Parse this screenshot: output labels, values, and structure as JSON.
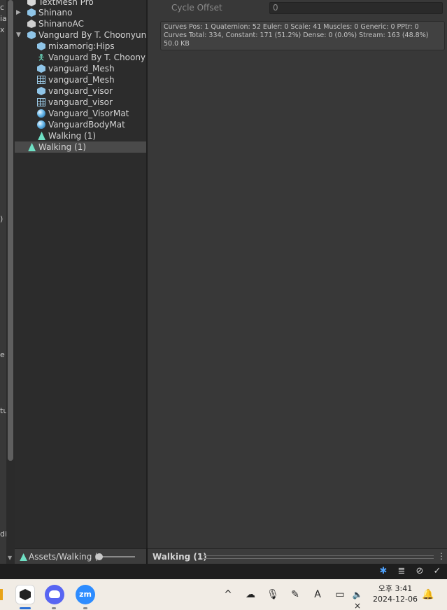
{
  "left_strip_fragments": [
    "c",
    "ia",
    "x",
    ")",
    "e",
    "tu",
    "di"
  ],
  "project_tree": {
    "items": [
      {
        "label": "TextMesh Pro",
        "icon": "cube-white-icon"
      },
      {
        "label": "Shinano",
        "icon": "prefab-cube-icon",
        "foldout": "▶"
      },
      {
        "label": "ShinanoAC",
        "icon": "animator-controller-icon"
      },
      {
        "label": "Vanguard By T. Choonyung",
        "icon": "model-prefab-icon",
        "foldout": "▼"
      },
      {
        "label": "mixamorig:Hips",
        "icon": "prefab-cube-icon"
      },
      {
        "label": "Vanguard By T. Choonyung",
        "icon": "avatar-icon"
      },
      {
        "label": "vanguard_Mesh",
        "icon": "prefab-cube-icon"
      },
      {
        "label": "vanguard_Mesh",
        "icon": "mesh-grid-icon"
      },
      {
        "label": "vanguard_visor",
        "icon": "prefab-cube-icon"
      },
      {
        "label": "vanguard_visor",
        "icon": "mesh-grid-icon"
      },
      {
        "label": "Vanguard_VisorMat",
        "icon": "material-sphere-icon"
      },
      {
        "label": "VanguardBodyMat",
        "icon": "material-sphere-icon"
      },
      {
        "label": "Walking (1)",
        "icon": "animation-clip-icon"
      },
      {
        "label": "Walking (1)",
        "icon": "animation-clip-icon"
      }
    ]
  },
  "inspector": {
    "cycle_offset_label": "Cycle Offset",
    "cycle_offset_value": "0",
    "info_lines": [
      "Curves Pos: 1 Quaternion: 52 Euler: 0 Scale: 41 Muscles: 0 Generic: 0 PPtr: 0",
      "Curves Total: 334, Constant: 171 (51.2%) Dense: 0 (0.0%) Stream: 163 (48.8%)",
      "50.0 KB"
    ]
  },
  "asset_path_bar": {
    "path_label": "Assets/Walking (",
    "icon": "animation-clip-icon",
    "icon_size_slider_value": 0.05
  },
  "preview_bar": {
    "title": "Walking (1)",
    "menu_icon": "⋮"
  },
  "status_bar": {
    "icons": [
      "debug-bug-icon",
      "cache-server-icon",
      "network-off-icon",
      "check-circle-icon"
    ]
  },
  "taskbar": {
    "apps": [
      {
        "name": "Unity",
        "icon": "unity-icon"
      },
      {
        "name": "Discord",
        "icon": "discord-icon"
      },
      {
        "name": "Zoom",
        "icon": "zoom-icon",
        "text": "zm"
      }
    ],
    "tray": {
      "chevron": "^",
      "ime_letter": "A",
      "mute_symbol": "×"
    },
    "clock_time": "오후 3:41",
    "clock_date": "2024-12-06"
  },
  "colors": {
    "panel_bg": "#383838",
    "tree_bg": "#2c2c2c",
    "selection": "#4a4a4a",
    "anim_accent": "#6fe0c4",
    "material_accent": "#68b8ea"
  }
}
